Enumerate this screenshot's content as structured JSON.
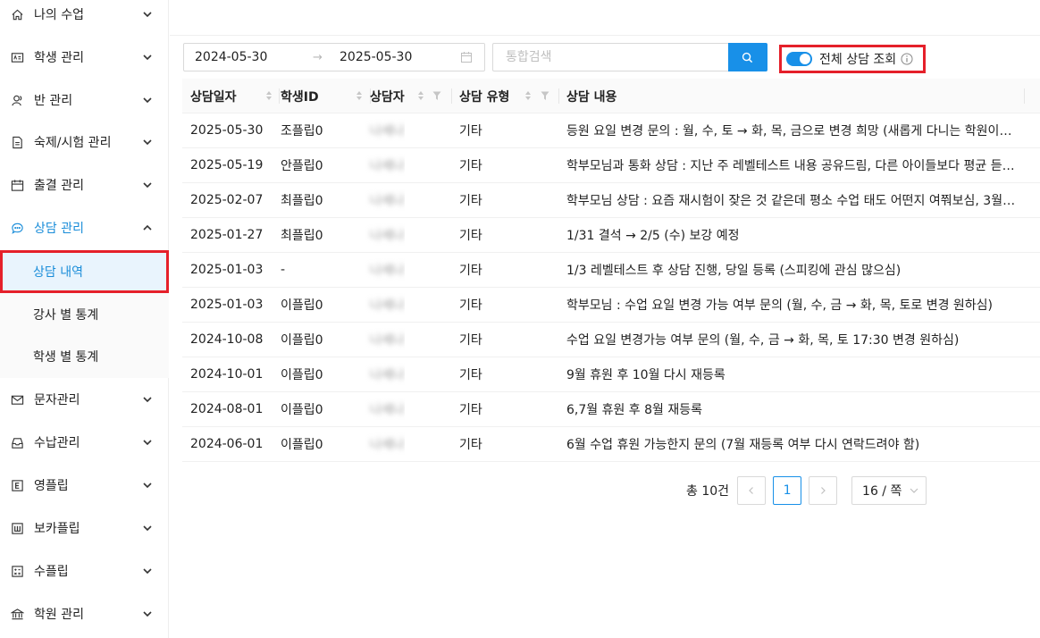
{
  "sidebar": {
    "items": [
      {
        "label": "나의 수업",
        "icon": "home-icon"
      },
      {
        "label": "학생 관리",
        "icon": "id-card-icon"
      },
      {
        "label": "반 관리",
        "icon": "users-icon"
      },
      {
        "label": "숙제/시험 관리",
        "icon": "document-icon"
      },
      {
        "label": "출결 관리",
        "icon": "calendar-icon"
      },
      {
        "label": "상담 관리",
        "icon": "chat-icon"
      },
      {
        "label": "문자관리",
        "icon": "mail-icon"
      },
      {
        "label": "수납관리",
        "icon": "inbox-icon"
      },
      {
        "label": "영플립",
        "icon": "e-box-icon"
      },
      {
        "label": "보카플립",
        "icon": "w-box-icon"
      },
      {
        "label": "수플립",
        "icon": "calculator-icon"
      },
      {
        "label": "학원 관리",
        "icon": "bank-icon"
      }
    ],
    "sub_items": [
      {
        "label": "상담 내역"
      },
      {
        "label": "강사 별 통계"
      },
      {
        "label": "학생 별 통계"
      }
    ]
  },
  "filters": {
    "date_start": "2024-05-30",
    "date_arrow": "→",
    "date_end": "2025-05-30",
    "search_placeholder": "통합검색",
    "toggle_label": "전체 상담 조회",
    "toggle_on": true
  },
  "colors": {
    "accent": "#1890e8",
    "highlight_border": "#e5202a"
  },
  "table": {
    "columns": [
      "상담일자",
      "학생ID",
      "상담자",
      "상담 유형",
      "상담 내용"
    ],
    "rows": [
      {
        "date": "2025-05-30",
        "student": "조플립0",
        "counselor": "나세나",
        "type": "기타",
        "content": "등원 요일 변경 문의 : 월, 수, 토 → 화, 목, 금으로 변경 희망 (새롭게 다니는 학원이랑 …"
      },
      {
        "date": "2025-05-19",
        "student": "안플립0",
        "counselor": "나세나",
        "type": "기타",
        "content": "학부모님과 통화 상담 : 지난 주 레벨테스트 내용 공유드림, 다른 아이들보다 평균 듣…"
      },
      {
        "date": "2025-02-07",
        "student": "최플립0",
        "counselor": "나세나",
        "type": "기타",
        "content": "학부모님 상담 : 요즘 재시험이 잦은 것 같은데 평소 수업 태도 어떤지 여쭤보심, 3월부…"
      },
      {
        "date": "2025-01-27",
        "student": "최플립0",
        "counselor": "나세나",
        "type": "기타",
        "content": "1/31 결석 → 2/5 (수) 보강 예정"
      },
      {
        "date": "2025-01-03",
        "student": "-",
        "counselor": "나세나",
        "type": "기타",
        "content": "1/3 레벨테스트 후 상담 진행, 당일 등록 (스피킹에 관심 많으심)"
      },
      {
        "date": "2025-01-03",
        "student": "이플립0",
        "counselor": "나세나",
        "type": "기타",
        "content": "학부모님 : 수업 요일 변경 가능 여부 문의 (월, 수, 금 → 화, 목, 토로 변경 원하심)"
      },
      {
        "date": "2024-10-08",
        "student": "이플립0",
        "counselor": "나세나",
        "type": "기타",
        "content": "수업 요일 변경가능 여부 문의 (월, 수, 금 → 화, 목, 토 17:30 변경 원하심)"
      },
      {
        "date": "2024-10-01",
        "student": "이플립0",
        "counselor": "나세나",
        "type": "기타",
        "content": "9월 휴원 후 10월 다시 재등록"
      },
      {
        "date": "2024-08-01",
        "student": "이플립0",
        "counselor": "나세나",
        "type": "기타",
        "content": "6,7월 휴원 후 8월 재등록"
      },
      {
        "date": "2024-06-01",
        "student": "이플립0",
        "counselor": "나세나",
        "type": "기타",
        "content": "6월 수업 휴원 가능한지 문의 (7월 재등록 여부 다시 연락드려야 함)"
      }
    ]
  },
  "pagination": {
    "total": "총 10건",
    "current_page": "1",
    "page_size": "16 / 쪽"
  }
}
